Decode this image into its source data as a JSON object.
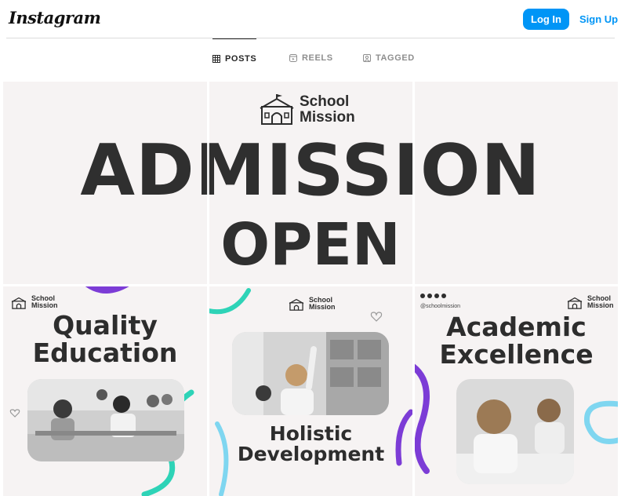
{
  "header": {
    "logo": "Instagram",
    "login_label": "Log In",
    "signup_label": "Sign Up"
  },
  "tabs": [
    {
      "label": "POSTS",
      "icon": "grid-icon",
      "active": true
    },
    {
      "label": "REELS",
      "icon": "reels-icon",
      "active": false
    },
    {
      "label": "TAGGED",
      "icon": "tagged-icon",
      "active": false
    }
  ],
  "posts": {
    "banner": {
      "brand_line1": "School",
      "brand_line2": "Mission",
      "headline1": "ADMISSION",
      "headline2": "OPEN"
    },
    "tile4": {
      "brand_line1": "School",
      "brand_line2": "Mission",
      "title_line1": "Quality",
      "title_line2": "Education"
    },
    "tile5": {
      "brand_line1": "School",
      "brand_line2": "Mission",
      "title_line1": "Holistic",
      "title_line2": "Development"
    },
    "tile6": {
      "brand_line1": "School",
      "brand_line2": "Mission",
      "handle": "@schoolmission",
      "title_line1": "Academic",
      "title_line2": "Excellence"
    }
  },
  "colors": {
    "accent": "#0095f6",
    "purple": "#7c3cd6",
    "teal": "#2ed3b7",
    "lightblue": "#7fd6f0",
    "tile_bg": "#f6f3f3"
  }
}
